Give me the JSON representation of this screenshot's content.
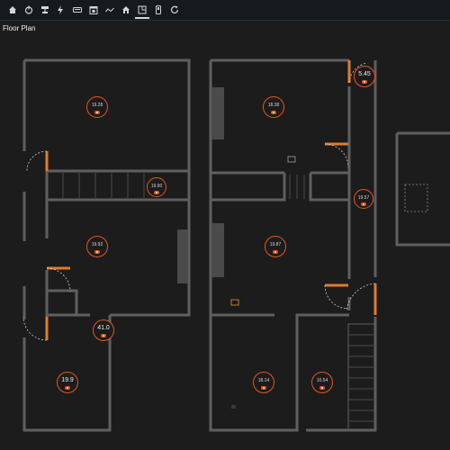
{
  "toolbar": {
    "icons": [
      "home-icon",
      "power-icon",
      "network-icon",
      "lightning-icon",
      "keyboard-icon",
      "calendar-icon",
      "graph-icon",
      "house-icon",
      "floorplan-icon",
      "device-icon",
      "refresh-icon"
    ],
    "active_index": 8,
    "accent": "#cfd8dc"
  },
  "page": {
    "title": "Floor Plan"
  },
  "colors": {
    "wall": "#5f5f5f",
    "door": "#e07a2f",
    "sensor": "#e8541f",
    "background": "#1c1c1c"
  },
  "sensors": [
    {
      "id": "sensor-1",
      "value": "19.28"
    },
    {
      "id": "sensor-2",
      "value": "18.38"
    },
    {
      "id": "sensor-3",
      "value": "5.45"
    },
    {
      "id": "sensor-4",
      "value": "19.90"
    },
    {
      "id": "sensor-5",
      "value": "19.57"
    },
    {
      "id": "sensor-6",
      "value": "19.92"
    },
    {
      "id": "sensor-7",
      "value": "19.87"
    },
    {
      "id": "sensor-8",
      "value": "41.0"
    },
    {
      "id": "sensor-9",
      "value": "19.9"
    },
    {
      "id": "sensor-10",
      "value": "18.14"
    },
    {
      "id": "sensor-11",
      "value": "10.54"
    }
  ]
}
